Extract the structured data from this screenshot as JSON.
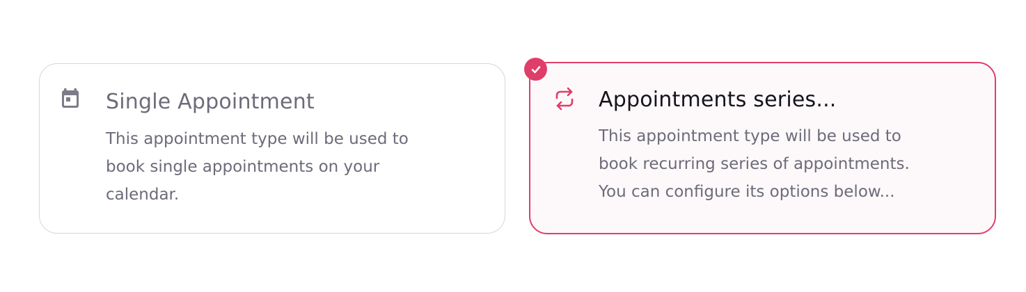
{
  "accent_color": "#df3e69",
  "options": [
    {
      "title": "Single Appointment",
      "description_lines": [
        "This appointment type will be used to",
        "book single appointments on your",
        "calendar."
      ],
      "icon": "calendar-icon",
      "selected": false
    },
    {
      "title": "Appointments series...",
      "description_lines": [
        "This appointment type will be used to",
        "book recurring series of appointments.",
        "You can configure its options below..."
      ],
      "icon": "repeat-icon",
      "selected": true
    }
  ]
}
